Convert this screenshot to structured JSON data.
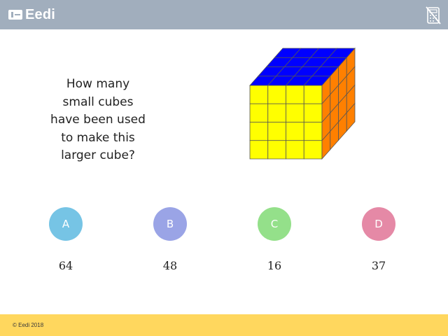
{
  "header": {
    "logo_text": "Eedi",
    "logo_icon": "eedi-logo-icon",
    "calculator_icon": "calculator-disabled-icon",
    "background_color": "#a1aebd"
  },
  "question": {
    "text": "How many small cubes have been used to make this larger cube?",
    "image_alt": "4 by 4 by 4 cube"
  },
  "cube_colors": {
    "top": "#0000ff",
    "front": "#ffff00",
    "side": "#ff8000"
  },
  "answers": [
    {
      "letter": "A",
      "value": "64",
      "color": "#76c4e5"
    },
    {
      "letter": "B",
      "value": "48",
      "color": "#9aa4e6"
    },
    {
      "letter": "C",
      "value": "16",
      "color": "#94e08a"
    },
    {
      "letter": "D",
      "value": "37",
      "color": "#e589a6"
    }
  ],
  "footer": {
    "copyright": "© Eedi 2018",
    "background_color": "#ffd75e"
  }
}
